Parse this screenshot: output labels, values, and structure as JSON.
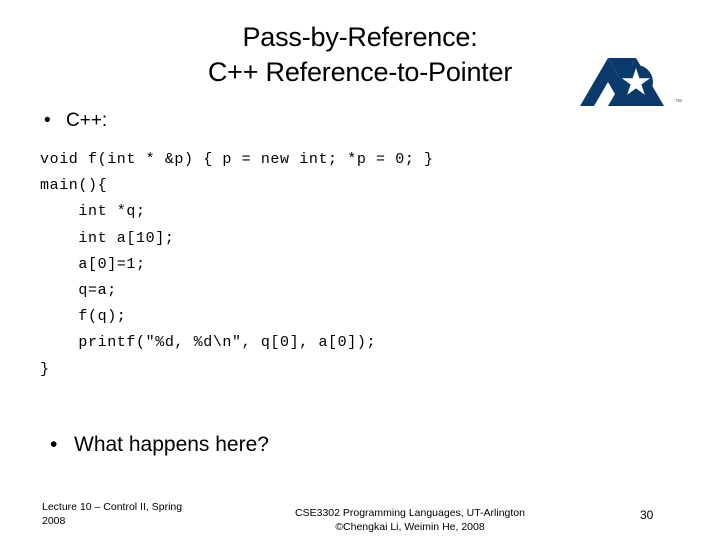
{
  "slide": {
    "title": "Pass-by-Reference:\nC++ Reference-to-Pointer",
    "bullet_one": "C++:",
    "bullet_marker": "•",
    "code": "void f(int * &p) { p = new int; *p = 0; }\nmain(){\n    int *q;\n    int a[10];\n    a[0]=1;\n    q=a;\n    f(q);\n    printf(\"%d, %d\\n\", q[0], a[0]);\n}",
    "bullet_two": "What happens here?",
    "logo_name": "uta-logo",
    "logo_colors": {
      "blue": "#0a3a6b",
      "white": "#ffffff"
    }
  },
  "footer": {
    "left": "Lecture 10 – Control II, Spring\n2008",
    "center": "CSE3302 Programming Languages, UT-Arlington\n©Chengkai Li, Weimin He, 2008",
    "page_number": "30"
  }
}
